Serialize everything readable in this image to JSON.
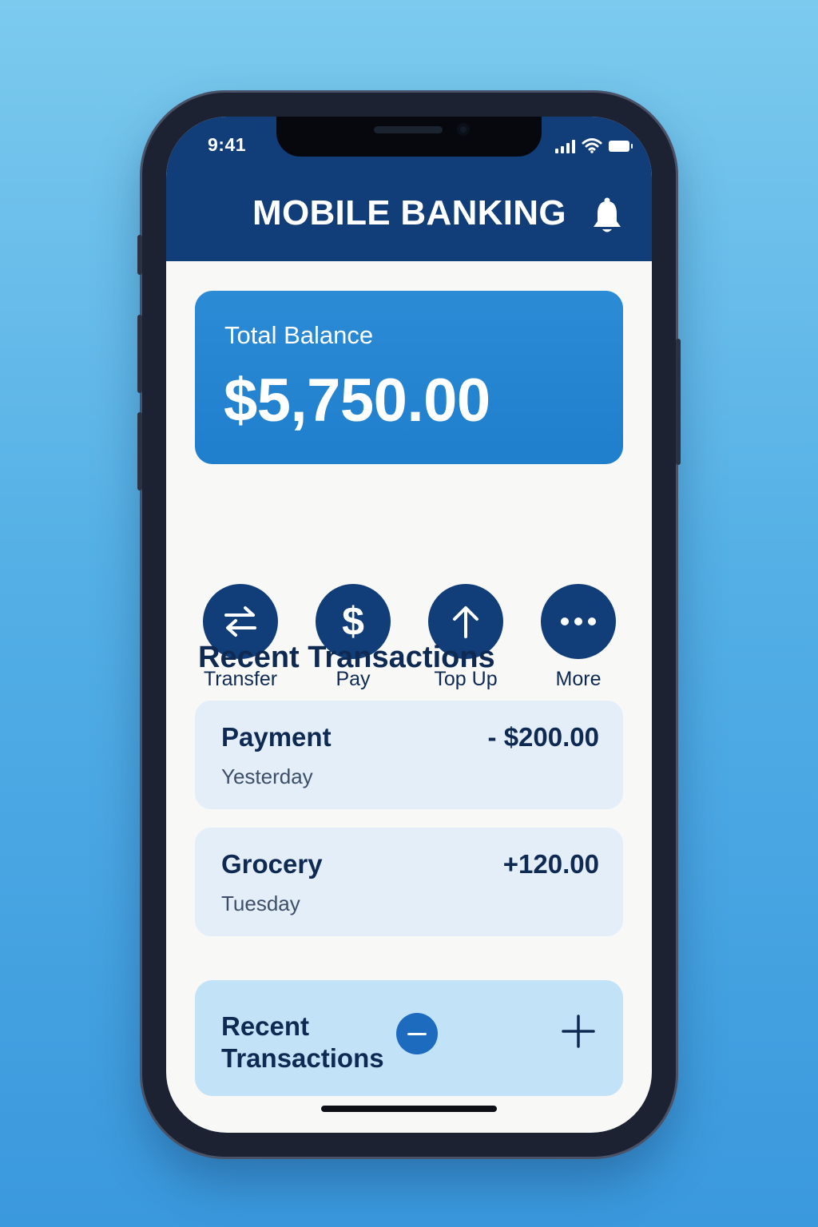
{
  "status_bar": {
    "time": "9:41",
    "icons": [
      "signal-icon",
      "wifi-icon",
      "battery-icon"
    ]
  },
  "header": {
    "title": "MOBILE BANKING",
    "notification_icon": "bell-icon"
  },
  "balance": {
    "label": "Total Balance",
    "amount": "$5,750.00"
  },
  "actions": [
    {
      "label": "Transfer",
      "icon": "transfer-arrows-icon"
    },
    {
      "label": "Pay",
      "icon": "dollar-icon"
    },
    {
      "label": "Top Up",
      "icon": "arrow-up-icon"
    },
    {
      "label": "More",
      "icon": "more-dots-icon"
    }
  ],
  "recent": {
    "title": "Recent Transactions",
    "transactions": [
      {
        "name": "Payment",
        "date": "Yesterday",
        "amount": "- $200.00"
      },
      {
        "name": "Grocery",
        "date": "Tuesday",
        "amount": "+120.00"
      }
    ]
  },
  "bottom_bar": {
    "label": "Recent Transactions",
    "minus_icon": "minus-icon",
    "plus_icon": "plus-icon"
  },
  "colors": {
    "header_bg": "#113e78",
    "balance_card": "#2086cf",
    "action_button": "#113e78",
    "transaction_card": "#e3eef9",
    "bottom_card": "#c2e2f8",
    "text_dark": "#0f2a52"
  }
}
